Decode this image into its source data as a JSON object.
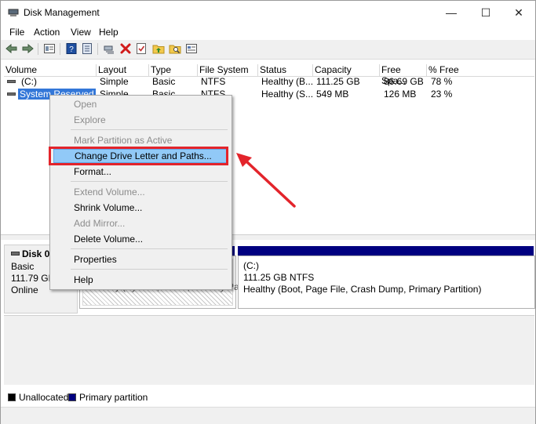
{
  "window": {
    "title": "Disk Management",
    "minimize_glyph": "—",
    "maximize_glyph": "☐",
    "close_glyph": "✕"
  },
  "menubar": {
    "items": [
      "File",
      "Action",
      "View",
      "Help"
    ]
  },
  "toolbar": {
    "icons": [
      "back-arrow-icon",
      "forward-arrow-icon",
      "list-view-icon",
      "help-book-icon",
      "properties-icon",
      "connect-icon",
      "delete-x-icon",
      "check-icon",
      "folder-up-icon",
      "search-folder-icon",
      "console-icon"
    ]
  },
  "table": {
    "columns": [
      "Volume",
      "Layout",
      "Type",
      "File System",
      "Status",
      "Capacity",
      "Free Spa...",
      "% Free"
    ],
    "rows": [
      {
        "volume": "(C:)",
        "layout": "Simple",
        "type": "Basic",
        "fs": "NTFS",
        "status": "Healthy (B...",
        "capacity": "111.25 GB",
        "free": "86.69 GB",
        "pct": "78 %"
      },
      {
        "volume": "System Reserved",
        "layout": "Simple",
        "type": "Basic",
        "fs": "NTFS",
        "status": "Healthy (S...",
        "capacity": "549 MB",
        "free": "126 MB",
        "pct": "23 %"
      }
    ]
  },
  "disk": {
    "name": "Disk 0",
    "type": "Basic",
    "size": "111.79 GB",
    "state": "Online",
    "reserved_status": "Healthy (System, Active, Primary Partition)",
    "c_name": "(C:)",
    "c_size": "111.25 GB NTFS",
    "c_status": "Healthy (Boot, Page File, Crash Dump, Primary Partition)"
  },
  "legend": {
    "unallocated": "Unallocated",
    "primary": "Primary partition",
    "unallocated_color": "#000000",
    "primary_color": "#000080"
  },
  "context_menu": {
    "open": "Open",
    "explore": "Explore",
    "mark_active": "Mark Partition as Active",
    "change_letter": "Change Drive Letter and Paths...",
    "format": "Format...",
    "extend": "Extend Volume...",
    "shrink": "Shrink Volume...",
    "add_mirror": "Add Mirror...",
    "delete": "Delete Volume...",
    "properties": "Properties",
    "help": "Help"
  },
  "colors": {
    "selection": "#3377d8",
    "highlight": "#91c9f7",
    "annotation_red": "#e3242b",
    "partition_blue": "#000080"
  }
}
